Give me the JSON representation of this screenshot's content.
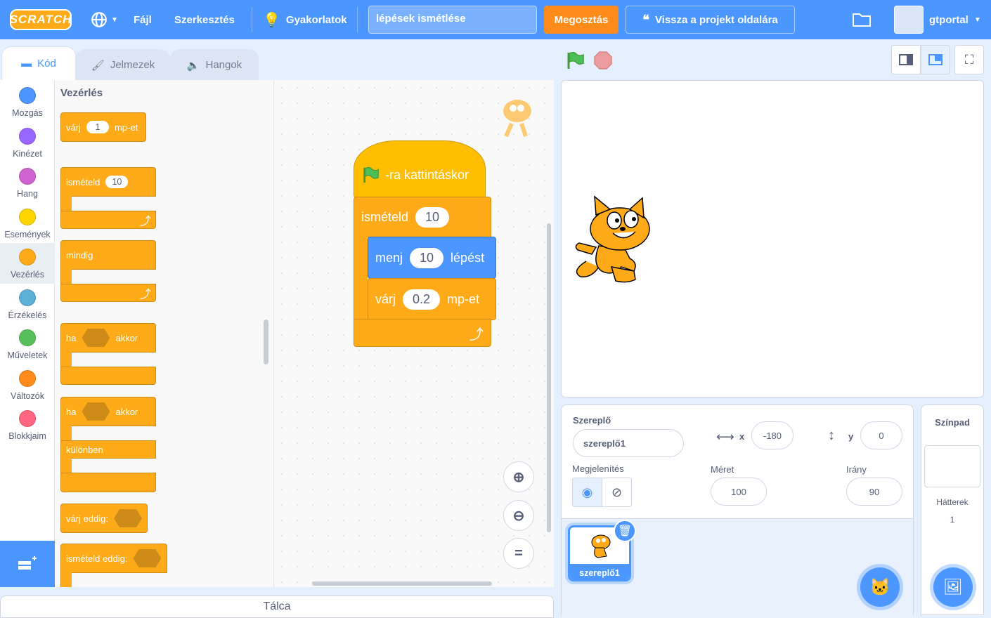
{
  "menubar": {
    "logo": "SCRATCH",
    "file": "Fájl",
    "edit": "Szerkesztés",
    "tutorials": "Gyakorlatok",
    "project_title": "lépések ismétlése",
    "share": "Megosztás",
    "see_project": "Vissza a projekt oldalára",
    "username": "gtportal"
  },
  "tabs": {
    "code": "Kód",
    "costumes": "Jelmezek",
    "sounds": "Hangok"
  },
  "categories": [
    {
      "label": "Mozgás",
      "color": "#4c97ff"
    },
    {
      "label": "Kinézet",
      "color": "#9966ff"
    },
    {
      "label": "Hang",
      "color": "#cf63cf"
    },
    {
      "label": "Események",
      "color": "#ffd500"
    },
    {
      "label": "Vezérlés",
      "color": "#ffab19"
    },
    {
      "label": "Érzékelés",
      "color": "#5cb1d6"
    },
    {
      "label": "Műveletek",
      "color": "#59c059"
    },
    {
      "label": "Változók",
      "color": "#ff8c1a"
    },
    {
      "label": "Blokkjaim",
      "color": "#ff6680"
    }
  ],
  "palette": {
    "heading": "Vezérlés",
    "wait": {
      "label": "várj",
      "value": "1",
      "suffix": "mp-et"
    },
    "repeat": {
      "label": "ismételd",
      "value": "10"
    },
    "forever": "mindig",
    "if_then": {
      "label": "ha",
      "suffix": "akkor"
    },
    "if_else": {
      "label": "ha",
      "suffix": "akkor",
      "else": "különben"
    },
    "wait_until": "várj eddig:",
    "repeat_until": "ismételd eddig:"
  },
  "script": {
    "hat": "-ra kattintáskor",
    "repeat_label": "ismételd",
    "repeat_value": "10",
    "move_label": "menj",
    "move_value": "10",
    "move_suffix": "lépést",
    "wait_label": "várj",
    "wait_value": "0.2",
    "wait_suffix": "mp-et"
  },
  "sprite_info": {
    "sprite_label": "Szereplő",
    "sprite_name": "szereplő1",
    "x_label": "x",
    "x_value": "-180",
    "y_label": "y",
    "y_value": "0",
    "show_label": "Megjelenítés",
    "size_label": "Méret",
    "size_value": "100",
    "direction_label": "Irány",
    "direction_value": "90"
  },
  "sprite_list": [
    {
      "name": "szereplő1"
    }
  ],
  "stage_panel": {
    "title": "Színpad",
    "backdrops_label": "Hátterek",
    "backdrops_count": "1"
  },
  "backpack": "Tálca"
}
